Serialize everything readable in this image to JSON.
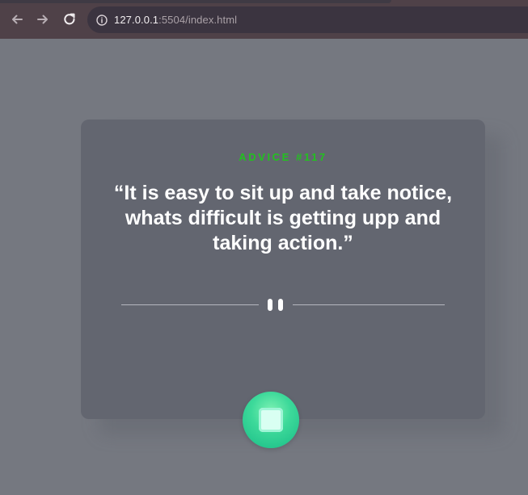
{
  "browser": {
    "url_host": "127.0.0.1",
    "url_path": ":5504/index.html",
    "icons": {
      "back": "arrow-left",
      "forward": "arrow-right",
      "reload": "reload",
      "site_info": "info-circle"
    }
  },
  "advice": {
    "label": "ADVICE #117",
    "quote": "“It is easy to sit up and take notice, whats difficult is getting upp and taking action.”"
  },
  "icons": {
    "divider_center": "pause-icon",
    "action_button": "dice-icon"
  },
  "colors": {
    "page_background": "#757880",
    "card_background": "#636670",
    "accent_green": "#22c11f",
    "button_green": "#3dd99a"
  }
}
